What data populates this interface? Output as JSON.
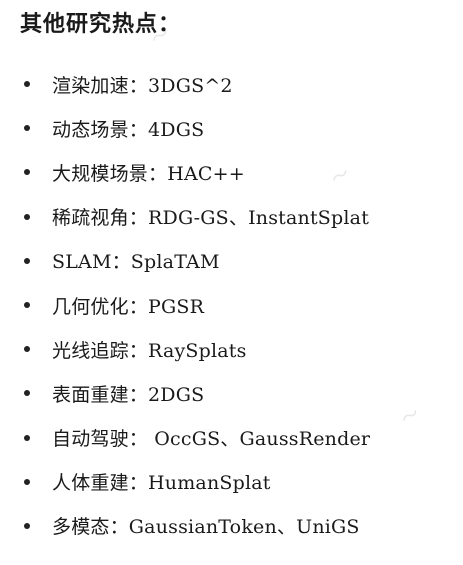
{
  "title": "其他研究热点：",
  "items": [
    "渲染加速：3DGS^2",
    "动态场景：4DGS",
    "大规模场景：HAC++",
    "稀疏视角：RDG-GS、InstantSplat",
    "SLAM：SplaTAM",
    "几何优化：PGSR",
    "光线追踪：RaySplats",
    "表面重建：2DGS",
    "自动驾驶： OccGS、GaussRender",
    "人体重建：HumanSplat",
    "多模态：GaussianToken、UniGS"
  ],
  "colors": {
    "text": "#1a1a1a",
    "bullet": "#222222",
    "watermark": "#e7e7e7"
  }
}
